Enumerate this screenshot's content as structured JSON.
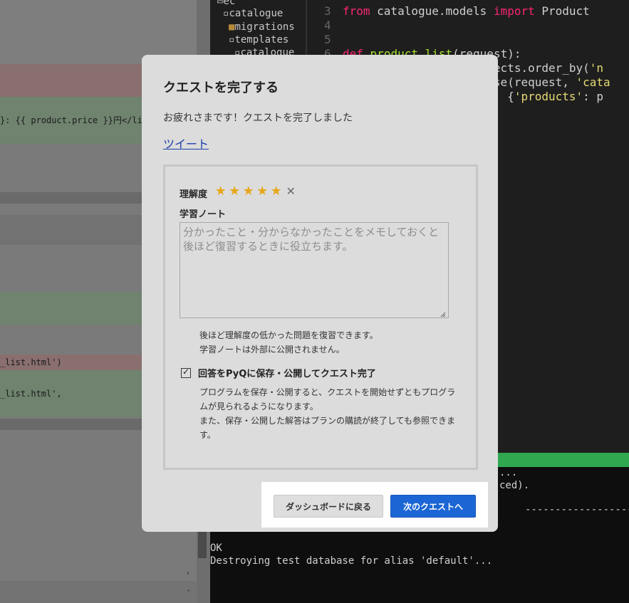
{
  "background": {
    "diff_lines": [
      "}: {{ product.price }}円</li>",
      "_list.html')",
      "_list.html',"
    ],
    "tree_items": [
      "ec",
      "catalogue",
      "migrations",
      "templates",
      "catalogue"
    ],
    "editor_lines": [
      {
        "n": "3",
        "text": "from catalogue.models import Product"
      },
      {
        "n": "4",
        "text": ""
      },
      {
        "n": "5",
        "text": ""
      },
      {
        "n": "6",
        "text": "def product_list(request):"
      },
      {
        "n": "",
        "text": "                   objects.order_by('n"
      },
      {
        "n": "",
        "text": "                   ponse(request, 'cata"
      },
      {
        "n": "",
        "text": "                        {'products': p"
      }
    ],
    "terminal_lines": [
      "...",
      "ced).",
      "------------------------------",
      "",
      "OK",
      "Destroying test database for alias 'default'..."
    ]
  },
  "modal": {
    "title": "クエストを完了する",
    "message": "お疲れさまです！クエストを完了しました",
    "tweet": "ツイート",
    "rating_label": "理解度",
    "rating": 5,
    "rating_max": 5,
    "note_label": "学習ノート",
    "note_placeholder": "分かったこと・分からなかったことをメモしておくと後ほど復習するときに役立ちます。",
    "note_value": "",
    "help_lines": [
      "後ほど理解度の低かった問題を復習できます。",
      "学習ノートは外部に公開されません。"
    ],
    "publish_checked": true,
    "publish_label": "回答をPyQに保存・公開してクエスト完了",
    "publish_desc_lines": [
      "プログラムを保存・公開すると、クエストを開始せずともプログラ",
      "ムが見られるようになります。",
      "また、保存・公開した解答はプランの購読が終了しても参照できま",
      "す。"
    ],
    "back_button": "ダッシュボードに戻る",
    "next_button": "次のクエストへ"
  },
  "colors": {
    "accent": "#1b66d4",
    "star": "#e7a71b",
    "link": "#1a3ea8",
    "terminal_bar": "#2fa84f"
  },
  "icons": {
    "star": "star-icon",
    "clear": "close-icon",
    "check": "checkbox-icon",
    "grip": "resize-grip-icon"
  }
}
